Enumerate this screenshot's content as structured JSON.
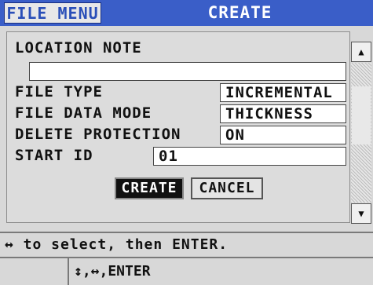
{
  "header": {
    "menu_label": "FILE MENU",
    "title": "CREATE"
  },
  "form": {
    "location_note": {
      "label": "LOCATION NOTE",
      "value": ""
    },
    "file_type": {
      "label": "FILE TYPE",
      "value": "INCREMENTAL"
    },
    "file_data_mode": {
      "label": "FILE DATA MODE",
      "value": "THICKNESS"
    },
    "delete_protection": {
      "label": "DELETE PROTECTION",
      "value": "ON"
    },
    "start_id": {
      "label": "START ID",
      "value": "01"
    }
  },
  "buttons": {
    "create": "CREATE",
    "cancel": "CANCEL"
  },
  "scrollbar": {
    "up_icon": "▲",
    "down_icon": "▼"
  },
  "hint": "↔ to select, then ENTER.",
  "keys": "↕,↔,ENTER"
}
